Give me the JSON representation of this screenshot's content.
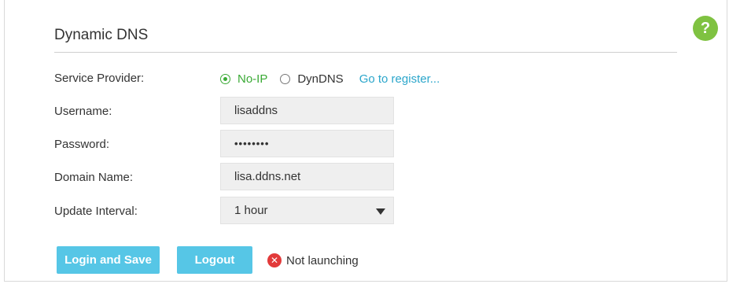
{
  "header": {
    "title": "Dynamic DNS"
  },
  "help": {
    "icon": "help-icon",
    "symbol": "?"
  },
  "fields": {
    "service_provider": {
      "label": "Service Provider:",
      "options": [
        "No-IP",
        "DynDNS"
      ],
      "selected": "No-IP",
      "register_link": "Go to register..."
    },
    "username": {
      "label": "Username:",
      "value": "lisaddns"
    },
    "password": {
      "label": "Password:",
      "value": "••••••••"
    },
    "domain_name": {
      "label": "Domain Name:",
      "value": "lisa.ddns.net"
    },
    "update_interval": {
      "label": "Update Interval:",
      "value": "1 hour"
    }
  },
  "actions": {
    "login_save_label": "Login and Save",
    "logout_label": "Logout"
  },
  "status": {
    "icon": "error-icon",
    "symbol": "✕",
    "text": "Not launching"
  },
  "colors": {
    "accent": "#56c6e6",
    "radio_selected": "#3aaa35",
    "help": "#7fc241",
    "error": "#e23a3a",
    "link": "#2ba6cb"
  }
}
